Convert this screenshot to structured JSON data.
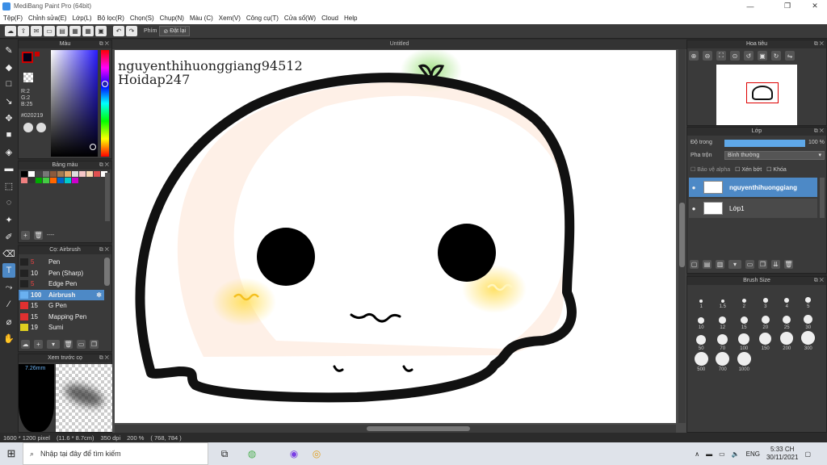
{
  "window": {
    "title": "MediBang Paint Pro (64bit)"
  },
  "menu": [
    "Tệp(F)",
    "Chỉnh sửa(E)",
    "Lớp(L)",
    "Bộ lọc(R)",
    "Chọn(S)",
    "Chụp(N)",
    "Màu (C)",
    "Xem(V)",
    "Công cụ(T)",
    "Cửa sổ(W)",
    "Cloud",
    "Help"
  ],
  "toolbar": {
    "phim_label": "Phím",
    "reset_label": "Đặt lại"
  },
  "panels": {
    "color": {
      "title": "Màu",
      "r": "R:2",
      "g": "G:2",
      "b": "B:25",
      "hex": "#020219",
      "main_color": "#020219"
    },
    "palette": {
      "title": "Bảng màu",
      "add_label": "----"
    },
    "brush": {
      "title": "Cọ: Airbrush",
      "items": [
        {
          "size": "5",
          "name": "Pen",
          "color": "#222222"
        },
        {
          "size": "10",
          "name": "Pen (Sharp)",
          "color": "#222222"
        },
        {
          "size": "5",
          "name": "Edge Pen",
          "color": "#222222"
        },
        {
          "size": "100",
          "name": "Airbrush",
          "color": "#4d89c6"
        },
        {
          "size": "15",
          "name": "G Pen",
          "color": "#e03030"
        },
        {
          "size": "15",
          "name": "Mapping Pen",
          "color": "#e03030"
        },
        {
          "size": "19",
          "name": "Sumi",
          "color": "#e0d020"
        }
      ]
    },
    "preview": {
      "title": "Xem trước cọ",
      "size": "7.26mm"
    },
    "navigator": {
      "title": "Hoa tiêu"
    },
    "layer": {
      "title": "Lớp",
      "opacity_label": "Độ trong",
      "opacity_value": "100 %",
      "blend_label": "Pha trộn",
      "blend_value": "Bình thường",
      "protect_alpha": "Bảo vệ alpha",
      "clipping": "Xén bớt",
      "lock": "Khóa",
      "layers": [
        "nguyenthihuonggiang",
        "Lớp1"
      ]
    },
    "brushsize": {
      "title": "Brush Size",
      "sizes": [
        "1",
        "1.5",
        "2",
        "3",
        "4",
        "5",
        "10",
        "12",
        "15",
        "20",
        "25",
        "30",
        "50",
        "70",
        "100",
        "150",
        "200",
        "300",
        "500",
        "700",
        "1000"
      ]
    }
  },
  "canvas": {
    "tab": "Untitled",
    "watermark_line1": "nguyenthihuonggiang94512",
    "watermark_line2": "Hoidap247"
  },
  "status": {
    "pixels": "1600 * 1200 pixel",
    "cm": "(11.6 * 8.7cm)",
    "dpi": "350 dpi",
    "zoom": "200 %",
    "coords": "( 768, 784 )"
  },
  "taskbar": {
    "search_placeholder": "Nhập tại đây để tìm kiếm",
    "lang": "ENG",
    "time": "5:33 CH",
    "date": "30/11/2021"
  }
}
